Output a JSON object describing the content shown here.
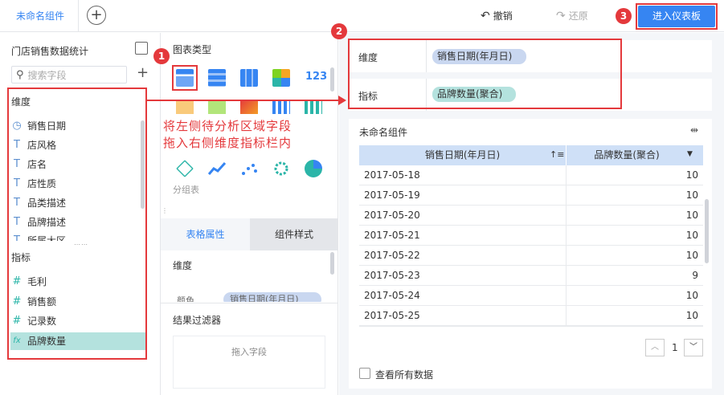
{
  "topbar": {
    "tab_label": "未命名组件",
    "undo_label": "撤销",
    "redo_label": "还原",
    "enter_dashboard_label": "进入仪表板"
  },
  "dataset": {
    "title": "门店销售数据统计",
    "search_placeholder": "搜索字段",
    "dimension_header": "维度",
    "dimensions": [
      {
        "icon": "clock-icon",
        "label": "销售日期"
      },
      {
        "icon": "text-icon",
        "label": "店风格"
      },
      {
        "icon": "text-icon",
        "label": "店名"
      },
      {
        "icon": "text-icon",
        "label": "店性质"
      },
      {
        "icon": "text-icon",
        "label": "品类描述"
      },
      {
        "icon": "text-icon",
        "label": "品牌描述"
      },
      {
        "icon": "text-icon",
        "label": "所属大区"
      }
    ],
    "measure_header": "指标",
    "measures": [
      {
        "icon": "hash-icon",
        "label": "毛利"
      },
      {
        "icon": "hash-icon",
        "label": "销售额"
      },
      {
        "icon": "hash-icon",
        "label": "记录数"
      },
      {
        "icon": "fx-icon",
        "label": "品牌数量"
      }
    ]
  },
  "chart_types": {
    "header": "图表类型",
    "group_label": "分组表"
  },
  "annotation": {
    "line1": "将左侧待分析区域字段",
    "line2": "拖入右侧维度指标栏内"
  },
  "badges": [
    "1",
    "2",
    "3"
  ],
  "properties": {
    "tab_table": "表格属性",
    "tab_style": "组件样式",
    "section_dimension": "维度",
    "color_label": "颜色",
    "color_chip": "销售日期(年月日)",
    "filter_header": "结果过滤器",
    "filter_drop": "拖入字段"
  },
  "shelf": {
    "dimension_label": "维度",
    "dimension_chip": "销售日期(年月日)",
    "measure_label": "指标",
    "measure_chip": "品牌数量(聚合)"
  },
  "preview": {
    "title": "未命名组件",
    "col1": "销售日期(年月日)",
    "col2": "品牌数量(聚合)",
    "rows": [
      {
        "date": "2017-05-18",
        "value": "10"
      },
      {
        "date": "2017-05-19",
        "value": "10"
      },
      {
        "date": "2017-05-20",
        "value": "10"
      },
      {
        "date": "2017-05-21",
        "value": "10"
      },
      {
        "date": "2017-05-22",
        "value": "10"
      },
      {
        "date": "2017-05-23",
        "value": "9"
      },
      {
        "date": "2017-05-24",
        "value": "10"
      },
      {
        "date": "2017-05-25",
        "value": "10"
      }
    ],
    "page_number": "1",
    "view_all_label": "查看所有数据"
  },
  "colors": {
    "accent": "#3685f2",
    "highlight": "#e4393c",
    "dimension_chip": "#c9d7f0",
    "measure_chip": "#b4e2de"
  }
}
